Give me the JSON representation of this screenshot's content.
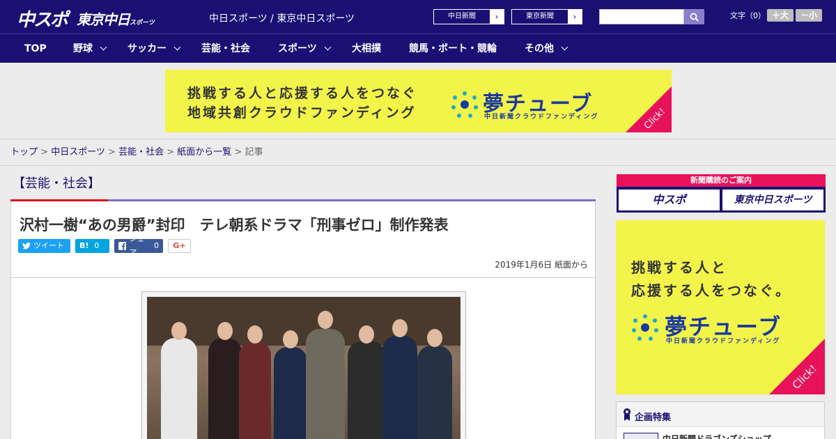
{
  "header": {
    "logo_chuspo": "中スポ",
    "logo_tokyo": "東京中日",
    "logo_tokyo_suffix": "スポーツ",
    "site_links": "中日スポーツ / 東京中日スポーツ",
    "paper_buttons": [
      "中日新聞",
      "東京新聞"
    ],
    "search_placeholder": "",
    "font_size_label": "文字（0）",
    "font_bigger": "＋大",
    "font_smaller": "－小"
  },
  "nav": {
    "items": [
      {
        "label": "TOP",
        "has_dropdown": false
      },
      {
        "label": "野球",
        "has_dropdown": true
      },
      {
        "label": "サッカー",
        "has_dropdown": true
      },
      {
        "label": "芸能・社会",
        "has_dropdown": false
      },
      {
        "label": "スポーツ",
        "has_dropdown": true
      },
      {
        "label": "大相撲",
        "has_dropdown": false
      },
      {
        "label": "競馬・ボート・競輪",
        "has_dropdown": false
      },
      {
        "label": "その他",
        "has_dropdown": true
      }
    ]
  },
  "banner": {
    "line1": "挑戦する人と応援する人をつなぐ",
    "line2": "地域共創クラウドファンディング",
    "brand": "夢チューブ",
    "brand_sub": "中日新聞クラウドファンディング",
    "click": "Click!"
  },
  "breadcrumb": {
    "items": [
      "トップ",
      "中日スポーツ",
      "芸能・社会",
      "紙面から一覧"
    ],
    "current": "記事",
    "sep": " > "
  },
  "article": {
    "section": "【芸能・社会】",
    "headline": "沢村一樹“あの男爵”封印　テレ朝系ドラマ「刑事ゼロ」制作発表",
    "share": {
      "tweet": "ツイート",
      "hatena_label": "B!",
      "hatena_count": "0",
      "facebook_label": "シェア",
      "facebook_count": "0",
      "gplus": "G+"
    },
    "date": "2019年1月6日 紙面から"
  },
  "sidebar": {
    "subscribe_title": "新聞購読のご案内",
    "subscribe_buttons": [
      "中スポ",
      "東京中日スポーツ"
    ],
    "ad": {
      "line1": "挑戦する人と",
      "line2": "応援する人をつなぐ。",
      "brand": "夢チューブ",
      "brand_sub": "中日新聞クラウドファンディング",
      "click": "Click!"
    },
    "feature_title": "企画特集",
    "feature_item": "中日新聞ドラゴンズショップ"
  },
  "colors": {
    "brand_navy": "#1a1073",
    "accent_red": "#d9131f",
    "ad_yellow": "#f2f44a",
    "ad_pink": "#e8125a",
    "twitter": "#1da1f2",
    "hatena": "#00a4de",
    "facebook": "#3b5998"
  }
}
